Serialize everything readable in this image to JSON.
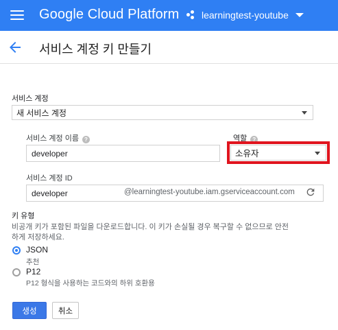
{
  "header": {
    "brand": "Google Cloud Platform",
    "project": "learningtest-youtube",
    "menu_icon": "hamburger-menu-icon",
    "project_icon": "project-dots-icon",
    "caret_icon": "caret-down-icon",
    "accent_color": "#2f7ff3"
  },
  "page": {
    "back_icon": "arrow-back-icon",
    "title": "서비스 계정 키 만들기"
  },
  "form": {
    "service_account": {
      "label": "서비스 계정",
      "selected": "새 서비스 계정"
    },
    "account_name": {
      "label": "서비스 계정 이름",
      "value": "developer",
      "help_icon": "help-icon"
    },
    "role": {
      "label": "역할",
      "selected": "소유자",
      "help_icon": "help-icon",
      "highlight_color": "#e0141e"
    },
    "account_id": {
      "label": "서비스 계정 ID",
      "value": "developer",
      "suffix": "@learningtest-youtube.iam.gserviceaccount.com",
      "refresh_icon": "refresh-icon"
    },
    "key_type": {
      "label": "키 유형",
      "description_line1": "비공개 키가 포함된 파일을 다운로드합니다. 이 키가 손실될 경우 복구할 수 없으므로 안전",
      "description_line2": "하게 저장하세요.",
      "options": [
        {
          "label": "JSON",
          "sub": "추천",
          "checked": true
        },
        {
          "label": "P12",
          "sub": "P12 형식을 사용하는 코드와의 하위 호환용",
          "checked": false
        }
      ]
    }
  },
  "buttons": {
    "create": "생성",
    "cancel": "취소"
  }
}
